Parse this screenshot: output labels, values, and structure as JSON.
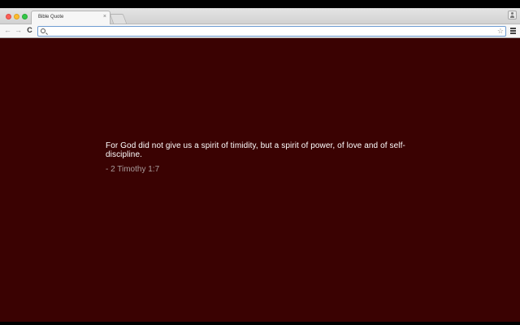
{
  "browser": {
    "tab_title": "Bible Quote",
    "tab_close": "×",
    "omnibox_value": "",
    "omnibox_placeholder": ""
  },
  "icons": {
    "back": "←",
    "forward": "→",
    "reload": "C",
    "star": "☆"
  },
  "quote": {
    "text": "For God did not give us a spirit of timidity, but a spirit of power, of love and of self-discipline.",
    "reference": "- 2 Timothy 1:7"
  },
  "colors": {
    "background": "#3a0202",
    "quote_text": "#ffffff",
    "reference_text": "#a89c9c"
  }
}
